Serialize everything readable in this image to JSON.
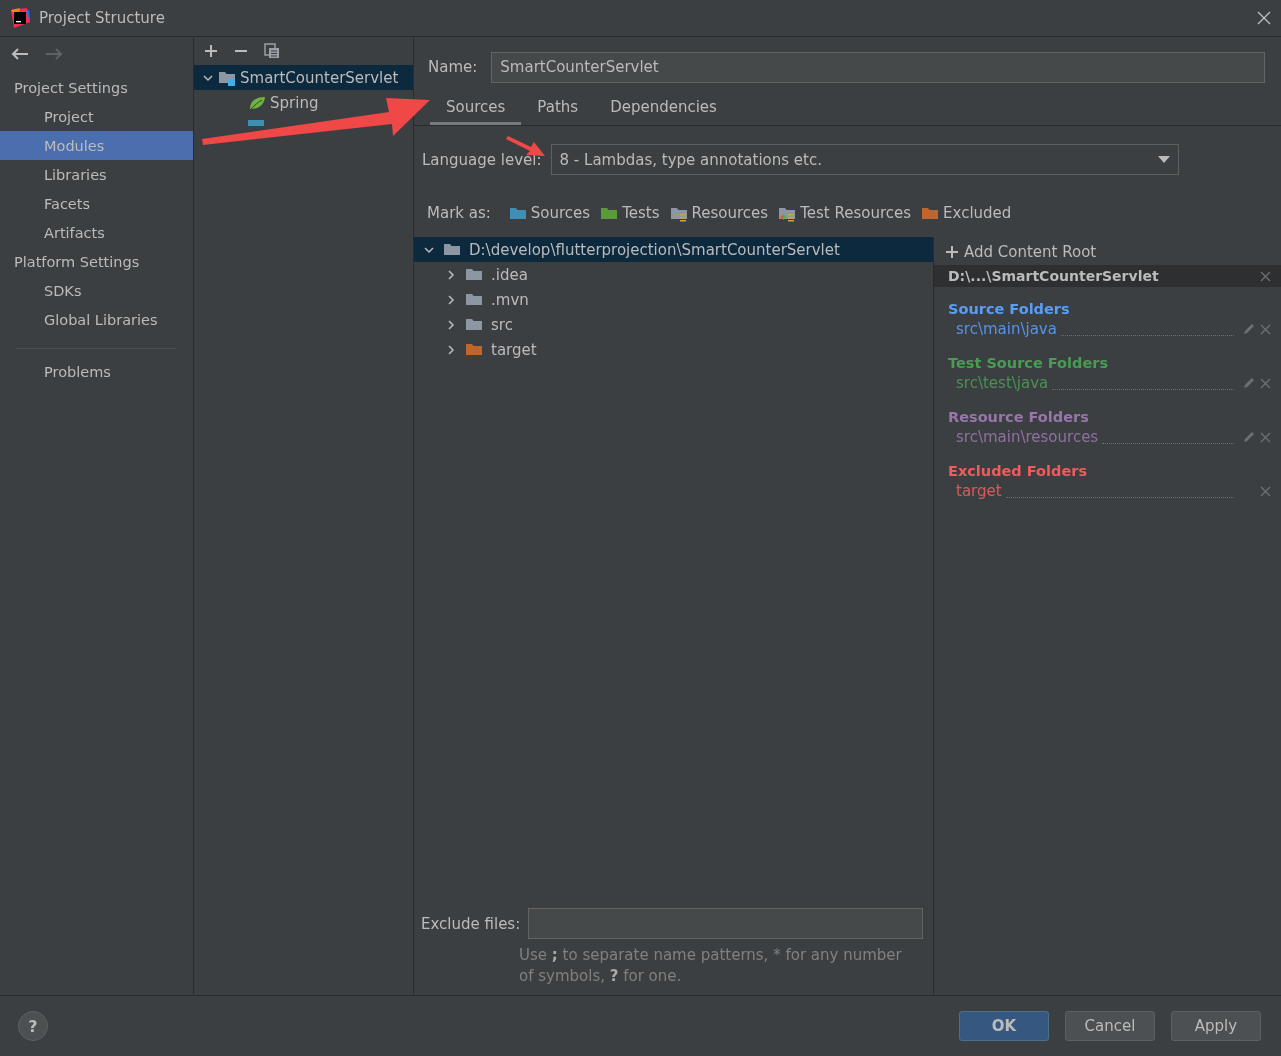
{
  "window": {
    "title": "Project Structure"
  },
  "nav_arrows": {
    "back_enabled": true,
    "forward_enabled": false
  },
  "nav": {
    "sections": [
      {
        "heading": "Project Settings",
        "items": [
          {
            "label": "Project",
            "selected": false
          },
          {
            "label": "Modules",
            "selected": true
          },
          {
            "label": "Libraries",
            "selected": false
          },
          {
            "label": "Facets",
            "selected": false
          },
          {
            "label": "Artifacts",
            "selected": false
          }
        ]
      },
      {
        "heading": "Platform Settings",
        "items": [
          {
            "label": "SDKs",
            "selected": false
          },
          {
            "label": "Global Libraries",
            "selected": false
          }
        ]
      }
    ],
    "extra_items": [
      {
        "label": "Problems",
        "selected": false
      }
    ]
  },
  "module_tree": {
    "items": [
      {
        "label": "SmartCounterServlet",
        "kind": "module",
        "expanded": true,
        "selected": true,
        "children": [
          {
            "label": "Spring",
            "kind": "spring",
            "selected": false
          },
          {
            "kind": "web",
            "selected": false
          }
        ]
      }
    ]
  },
  "name_field": {
    "label": "Name:",
    "value": "SmartCounterServlet"
  },
  "tabs": [
    {
      "label": "Sources",
      "selected": true
    },
    {
      "label": "Paths",
      "selected": false
    },
    {
      "label": "Dependencies",
      "selected": false
    }
  ],
  "language_level": {
    "label": "Language level:",
    "value": "8 - Lambdas, type annotations etc."
  },
  "mark_as": {
    "label": "Mark as:",
    "buttons": [
      {
        "label": "Sources",
        "kind": "sources"
      },
      {
        "label": "Tests",
        "kind": "tests"
      },
      {
        "label": "Resources",
        "kind": "resources"
      },
      {
        "label": "Test Resources",
        "kind": "test_resources"
      },
      {
        "label": "Excluded",
        "kind": "excluded"
      }
    ]
  },
  "file_tree": {
    "items": [
      {
        "label": "D:\\develop\\flutterprojection\\SmartCounterServlet",
        "kind": "folder",
        "expanded": true,
        "selected": true,
        "children": [
          {
            "label": ".idea",
            "kind": "folder",
            "expanded": false,
            "selected": false
          },
          {
            "label": ".mvn",
            "kind": "folder",
            "expanded": false,
            "selected": false
          },
          {
            "label": "src",
            "kind": "folder",
            "expanded": false,
            "selected": false
          },
          {
            "label": "target",
            "kind": "excluded",
            "expanded": false,
            "selected": false
          }
        ]
      }
    ]
  },
  "content_root": {
    "add_label": "Add Content Root",
    "root": "D:\\...\\SmartCounterServlet",
    "groups": [
      {
        "title": "Source Folders",
        "color": "#589df6",
        "folders": [
          {
            "path": "src\\main\\java",
            "editable": true
          }
        ]
      },
      {
        "title": "Test Source Folders",
        "color": "#499c54",
        "folders": [
          {
            "path": "src\\test\\java",
            "editable": true
          }
        ]
      },
      {
        "title": "Resource Folders",
        "color": "#9876aa",
        "folders": [
          {
            "path": "src\\main\\resources",
            "editable": true
          }
        ]
      },
      {
        "title": "Excluded Folders",
        "color": "#ee5c5c",
        "folders": [
          {
            "path": "target",
            "editable": false
          }
        ]
      }
    ]
  },
  "exclude_files": {
    "label": "Exclude files:",
    "hint": "Use **;** to separate name patterns, * for any number of symbols, **?** for one."
  },
  "help_button": {
    "label": "?"
  },
  "footer": {
    "buttons": [
      {
        "label": "OK",
        "default": true
      },
      {
        "label": "Cancel",
        "default": false
      },
      {
        "label": "Apply",
        "default": false
      }
    ]
  }
}
